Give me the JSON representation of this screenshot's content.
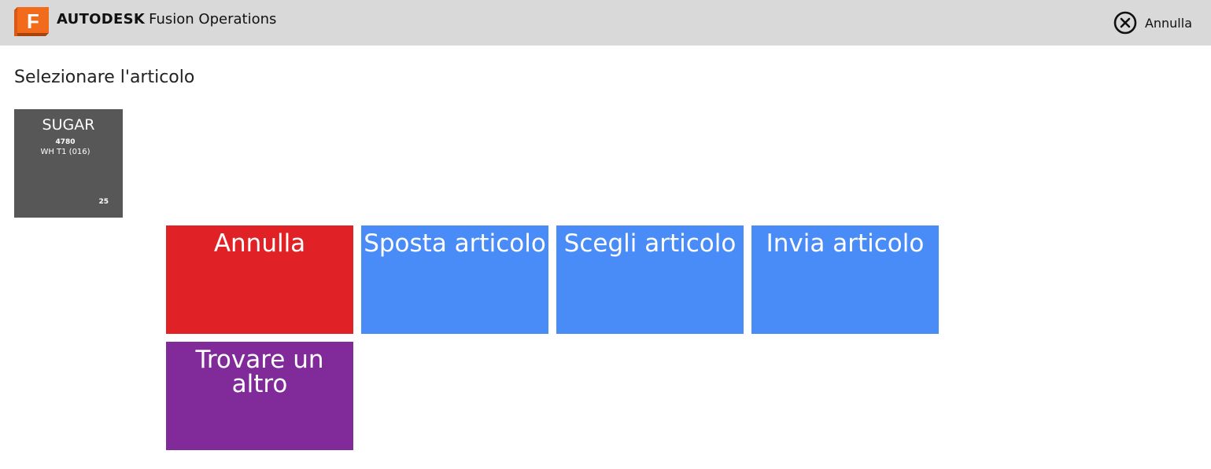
{
  "header": {
    "brand_strong": "AUTODESK",
    "brand_product": "Fusion Operations",
    "logo_letter": "F",
    "logo_color": "#f26b1d",
    "cancel_label": "Annulla",
    "cancel_icon": "close-circle-icon"
  },
  "page": {
    "title": "Selezionare l'articolo"
  },
  "item": {
    "name": "SUGAR",
    "code": "4780",
    "location": "WH T1 (016)",
    "quantity": "25",
    "color": "#575757"
  },
  "actions": [
    {
      "label": "Annulla",
      "color": "#e02126"
    },
    {
      "label": "Sposta articolo",
      "color": "#4a8cf7"
    },
    {
      "label": "Scegli articolo",
      "color": "#4a8cf7"
    },
    {
      "label": "Invia articolo",
      "color": "#4a8cf7"
    },
    {
      "label": "Trovare un altro",
      "color": "#812a9a"
    }
  ]
}
